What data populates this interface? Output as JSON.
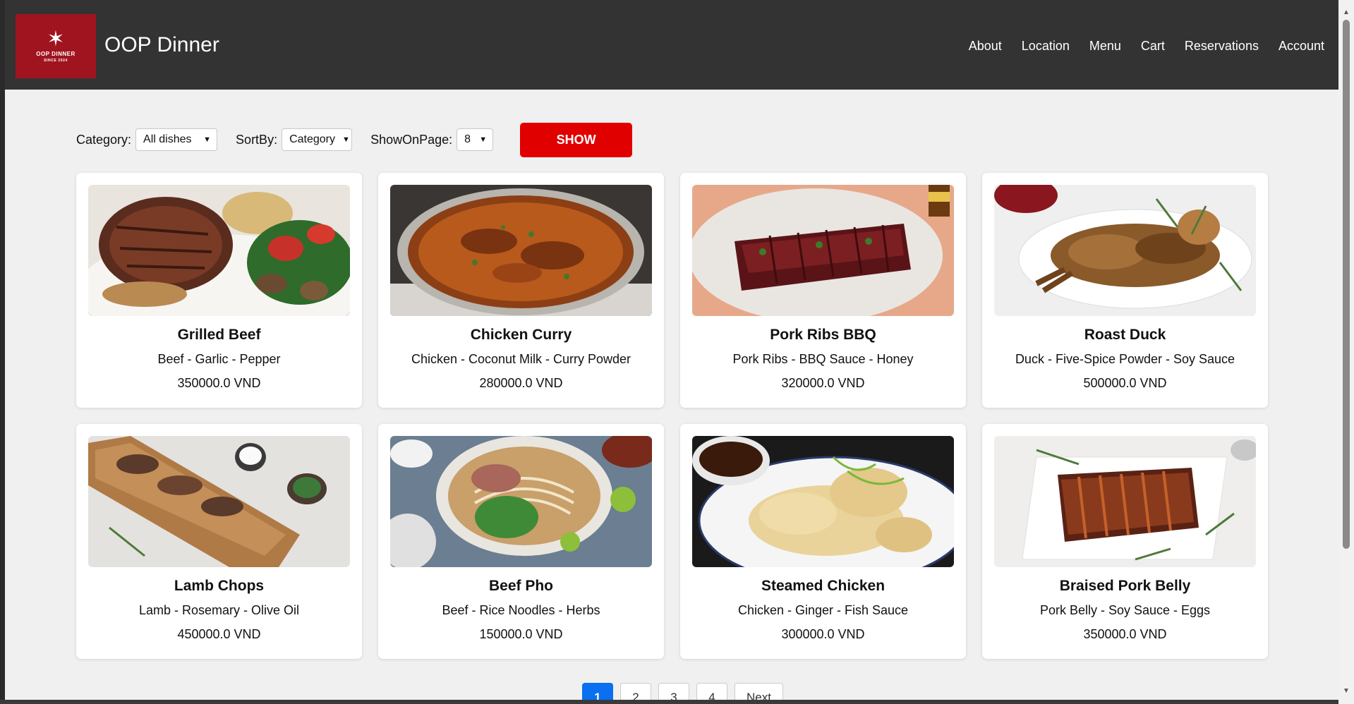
{
  "header": {
    "logo_text": "OOP DINNER",
    "logo_sub": "SINCE 2024",
    "title": "OOP Dinner",
    "nav": [
      "About",
      "Location",
      "Menu",
      "Cart",
      "Reservations",
      "Account"
    ]
  },
  "filters": {
    "category_label": "Category:",
    "category_value": "All dishes",
    "sortby_label": "SortBy:",
    "sortby_value": "Category",
    "showonpage_label": "ShowOnPage:",
    "showonpage_value": "8",
    "show_button": "SHOW"
  },
  "dishes": [
    {
      "name": "Grilled Beef",
      "ingredients": "Beef - Garlic - Pepper",
      "price": "350000.0 VND",
      "image": "grilled-beef"
    },
    {
      "name": "Chicken Curry",
      "ingredients": "Chicken - Coconut Milk - Curry Powder",
      "price": "280000.0 VND",
      "image": "chicken-curry"
    },
    {
      "name": "Pork Ribs BBQ",
      "ingredients": "Pork Ribs - BBQ Sauce - Honey",
      "price": "320000.0 VND",
      "image": "pork-ribs"
    },
    {
      "name": "Roast Duck",
      "ingredients": "Duck - Five-Spice Powder - Soy Sauce",
      "price": "500000.0 VND",
      "image": "roast-duck"
    },
    {
      "name": "Lamb Chops",
      "ingredients": "Lamb - Rosemary - Olive Oil",
      "price": "450000.0 VND",
      "image": "lamb-chops"
    },
    {
      "name": "Beef Pho",
      "ingredients": "Beef - Rice Noodles - Herbs",
      "price": "150000.0 VND",
      "image": "beef-pho"
    },
    {
      "name": "Steamed Chicken",
      "ingredients": "Chicken - Ginger - Fish Sauce",
      "price": "300000.0 VND",
      "image": "steamed-chicken"
    },
    {
      "name": "Braised Pork Belly",
      "ingredients": "Pork Belly - Soy Sauce - Eggs",
      "price": "350000.0 VND",
      "image": "braised-pork"
    }
  ],
  "pagination": {
    "pages": [
      "1",
      "2",
      "3",
      "4"
    ],
    "active": "1",
    "next": "Next"
  },
  "colors": {
    "header_bg": "#333333",
    "logo_bg": "#a0141f",
    "show_button": "#e00000",
    "active_page": "#0a6ff0"
  }
}
